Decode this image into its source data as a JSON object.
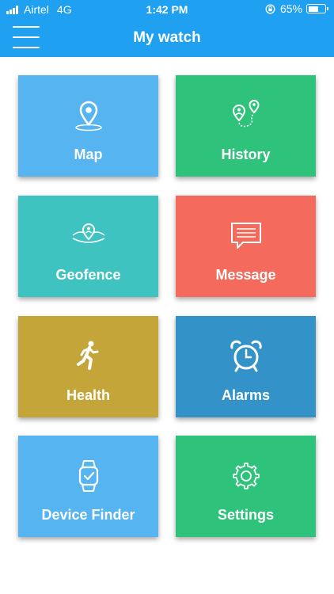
{
  "status_bar": {
    "carrier": "Airtel",
    "network": "4G",
    "time": "1:42 PM",
    "battery": "65%",
    "battery_level": 0.65
  },
  "header": {
    "title": "My watch",
    "background": "#1fa0f0"
  },
  "tiles": [
    {
      "label": "Map",
      "icon": "map-pin-icon",
      "color": "#56b4f0"
    },
    {
      "label": "History",
      "icon": "route-history-icon",
      "color": "#2ec27a"
    },
    {
      "label": "Geofence",
      "icon": "geofence-icon",
      "color": "#3fc3c0"
    },
    {
      "label": "Message",
      "icon": "message-icon",
      "color": "#f46a5c"
    },
    {
      "label": "Health",
      "icon": "runner-icon",
      "color": "#c4a53a"
    },
    {
      "label": "Alarms",
      "icon": "alarm-clock-icon",
      "color": "#3393c8"
    },
    {
      "label": "Device Finder",
      "icon": "smartwatch-icon",
      "color": "#56b4f0"
    },
    {
      "label": "Settings",
      "icon": "gear-icon",
      "color": "#2ec27a"
    }
  ]
}
